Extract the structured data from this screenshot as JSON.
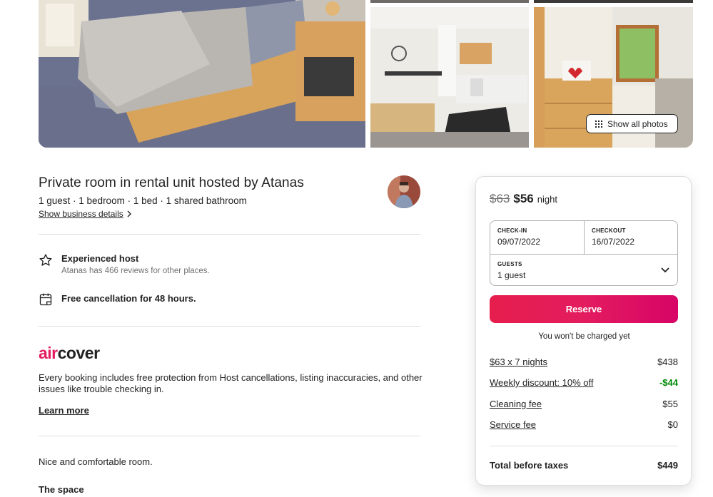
{
  "gallery": {
    "show_all_label": "Show all photos"
  },
  "listing": {
    "title": "Private room in rental unit hosted by Atanas",
    "subtitle": "1 guest · 1 bedroom · 1 bed · 1 shared bathroom",
    "business_link": "Show business details"
  },
  "highlights": [
    {
      "icon": "star-icon",
      "title": "Experienced host",
      "desc": "Atanas has 466 reviews for other places."
    },
    {
      "icon": "calendar-icon",
      "title": "Free cancellation for 48 hours.",
      "desc": ""
    }
  ],
  "aircover": {
    "logo_air": "air",
    "logo_cover": "cover",
    "text": "Every booking includes free protection from Host cancellations, listing inaccuracies, and other issues like trouble checking in.",
    "learn_more": "Learn more"
  },
  "description": "Nice and comfortable room.",
  "space_title": "The space",
  "booking": {
    "old_price": "$63",
    "new_price": "$56",
    "per_night": "night",
    "checkin_label": "CHECK-IN",
    "checkin_value": "09/07/2022",
    "checkout_label": "CHECKOUT",
    "checkout_value": "16/07/2022",
    "guests_label": "GUESTS",
    "guests_value": "1 guest",
    "reserve_label": "Reserve",
    "not_charged": "You won't be charged yet",
    "fees": [
      {
        "label": "$63 x 7 nights",
        "amount": "$438"
      },
      {
        "label": "Weekly discount: 10% off",
        "amount": "-$44"
      },
      {
        "label": "Cleaning fee",
        "amount": "$55"
      },
      {
        "label": "Service fee",
        "amount": "$0"
      }
    ],
    "total_label": "Total before taxes",
    "total_amount": "$449"
  },
  "colors": {
    "brand": "#e31c5f",
    "discount": "#008a05",
    "text": "#222222",
    "muted": "#717171"
  }
}
